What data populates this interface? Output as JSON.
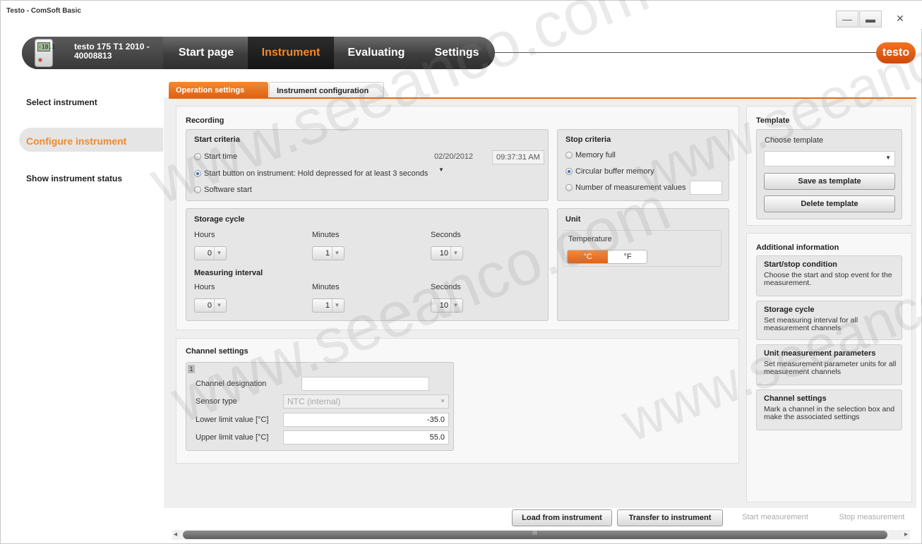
{
  "window": {
    "title": "Testo - ComSoft Basic",
    "minimize": "—",
    "maximize": "▬",
    "close": "✕"
  },
  "nav": {
    "device_lcd": "-18.1",
    "device_name_line1": "testo 175 T1 2010 -",
    "device_name_line2": "40008813",
    "tabs": [
      "Start page",
      "Instrument",
      "Evaluating",
      "Settings"
    ],
    "active_tab": "Instrument",
    "logo": "testo"
  },
  "sidebar": {
    "items": [
      "Select instrument",
      "Configure instrument",
      "Show instrument status"
    ],
    "active": "Configure instrument"
  },
  "subtabs": [
    "Operation settings",
    "Instrument configuration"
  ],
  "recording": {
    "title": "Recording",
    "start": {
      "title": "Start criteria",
      "options": [
        "Start time",
        "Start button on instrument: Hold depressed for at least 3 seconds",
        "Software start"
      ],
      "selected": 1,
      "date": "02/20/2012",
      "time": "09:37:31 AM"
    },
    "stop": {
      "title": "Stop criteria",
      "options": [
        "Memory full",
        "Circular buffer memory",
        "Number of measurement values"
      ],
      "selected": 1,
      "count_value": ""
    },
    "storage_cycle": {
      "title": "Storage cycle",
      "labels": [
        "Hours",
        "Minutes",
        "Seconds"
      ],
      "values": [
        "0",
        "1",
        "10"
      ]
    },
    "measuring_interval": {
      "title": "Measuring interval",
      "labels": [
        "Hours",
        "Minutes",
        "Seconds"
      ],
      "values": [
        "0",
        "1",
        "10"
      ]
    },
    "unit": {
      "title": "Unit",
      "temp_label": "Temperature",
      "options": [
        "°C",
        "°F"
      ],
      "selected": "°C"
    }
  },
  "channel": {
    "title": "Channel settings",
    "number": "1",
    "designation_label": "Channel designation",
    "designation_value": "",
    "sensor_label": "Sensor type",
    "sensor_value": "NTC (internal)",
    "lower_label": "Lower limit value   [°C]",
    "lower_value": "-35.0",
    "upper_label": "Upper limit value   [°C]",
    "upper_value": "55.0"
  },
  "template": {
    "title": "Template",
    "choose_label": "Choose template",
    "selected": "",
    "save": "Save as template",
    "delete": "Delete template"
  },
  "additional": {
    "title": "Additional information",
    "cards": [
      {
        "title": "Start/stop condition",
        "desc": "Choose the start and stop event for the measurement."
      },
      {
        "title": "Storage cycle",
        "desc": "Set measuring interval for all measurement channels"
      },
      {
        "title": "Unit measurement parameters",
        "desc": "Set measurement parameter units for all measurement channels"
      },
      {
        "title": "Channel settings",
        "desc": "Mark a channel in the selection box and make the associated settings"
      }
    ]
  },
  "actions": {
    "load": "Load from instrument",
    "transfer": "Transfer to instrument",
    "start": "Start measurement",
    "stop": "Stop measurement"
  },
  "scrollbar": {
    "grip": "III",
    "left": "◂",
    "right": "▸"
  },
  "watermarks": [
    "www.seeanco.com"
  ],
  "colors": {
    "accent": "#f08a2c",
    "tab_active": "#e06a1a"
  }
}
